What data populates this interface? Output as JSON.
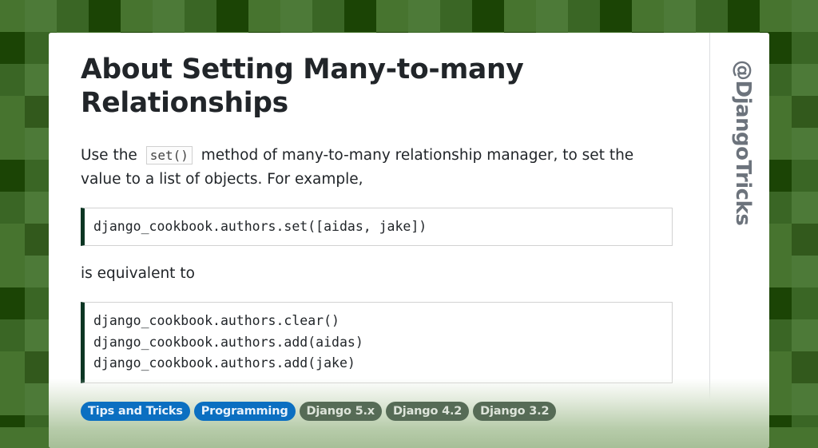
{
  "colors": {
    "tile_palette": [
      "#47742f",
      "#4d7a38",
      "#3a6625",
      "#1b4405",
      "#32591c"
    ],
    "code_accent": "#0c3623",
    "tag_blue": "#0b6fc1",
    "tag_gray": "#566b56",
    "handle_text": "#6c737c"
  },
  "article": {
    "title": "About Setting Many-to-many Relationships",
    "intro_before_code": "Use the",
    "intro_code": "set()",
    "intro_after_code": "method of many-to-many relationship manager, to set the value to a list of objects. For example,",
    "code_block_1": [
      "django_cookbook.authors.set([aidas, jake])"
    ],
    "equivalent_text": "is equivalent to",
    "code_block_2": [
      "django_cookbook.authors.clear()",
      "django_cookbook.authors.add(aidas)",
      "django_cookbook.authors.add(jake)"
    ]
  },
  "tags": [
    {
      "label": "Tips and Tricks",
      "style": "blue"
    },
    {
      "label": "Programming",
      "style": "blue"
    },
    {
      "label": "Django 5.x",
      "style": "gray"
    },
    {
      "label": "Django 4.2",
      "style": "gray"
    },
    {
      "label": "Django 3.2",
      "style": "gray"
    }
  ],
  "sidebar": {
    "handle": "@DjangoTricks"
  }
}
